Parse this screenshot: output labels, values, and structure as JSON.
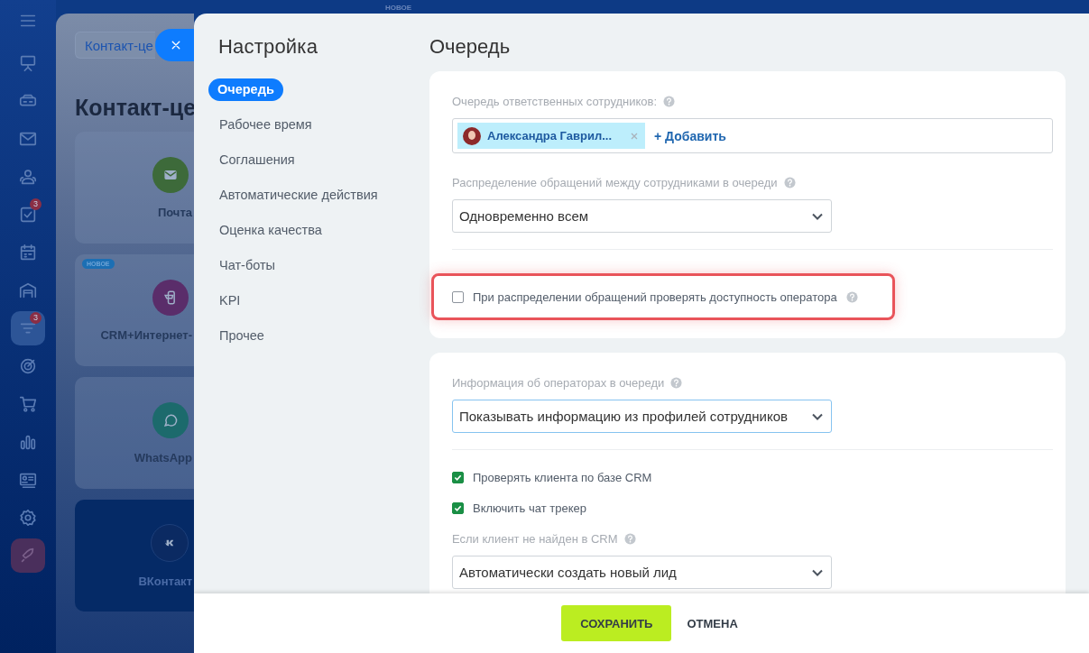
{
  "rail": {
    "items": [
      {
        "selected": false
      },
      {
        "selected": false
      },
      {
        "selected": false
      },
      {
        "selected": false
      },
      {
        "selected": false,
        "badge": "3"
      },
      {
        "selected": false
      },
      {
        "selected": false
      },
      {
        "selected": true,
        "badge": "3"
      },
      {
        "selected": false
      },
      {
        "selected": false
      },
      {
        "selected": false
      },
      {
        "selected": false
      },
      {
        "selected": false
      },
      {
        "selected": false
      }
    ]
  },
  "background_page": {
    "top_badge": "НОВОЕ",
    "breadcrumb": "Контакт-це",
    "title": "Контакт-це",
    "tiles": [
      {
        "label": "Почта",
        "color": "#3d6a3a",
        "selected": false
      },
      {
        "label": "CRM+Интернет-",
        "color": "#5a2d6a",
        "selected": false,
        "badge": "НОВОЕ"
      },
      {
        "label": "WhatsApp",
        "color": "#1c6a6c",
        "selected": false
      },
      {
        "label": "ВКонтакт",
        "color": "#0b2a62",
        "selected": true
      }
    ]
  },
  "settings": {
    "title": "Настройка",
    "nav": [
      {
        "label": "Очередь",
        "selected": true
      },
      {
        "label": "Рабочее время",
        "selected": false
      },
      {
        "label": "Соглашения",
        "selected": false
      },
      {
        "label": "Автоматические действия",
        "selected": false
      },
      {
        "label": "Оценка качества",
        "selected": false
      },
      {
        "label": "Чат-боты",
        "selected": false
      },
      {
        "label": "KPI",
        "selected": false
      },
      {
        "label": "Прочее",
        "selected": false
      }
    ],
    "heading": "Очередь",
    "cards": [
      {
        "fields": [
          {
            "kind": "people",
            "label": "Очередь ответственных сотрудников:",
            "help": true,
            "chips": [
              {
                "name": "Александра Гаврил..."
              }
            ],
            "add": "+ Добавить"
          },
          {
            "kind": "select",
            "label": "Распределение обращений между сотрудниками в очереди",
            "help": true,
            "value": "Одновременно всем",
            "focused": false
          },
          {
            "kind": "divider"
          },
          {
            "kind": "checkbox",
            "label": "При распределении обращений проверять доступность оператора",
            "help": true,
            "checked": false,
            "highlighted": true
          }
        ]
      },
      {
        "fields": [
          {
            "kind": "select",
            "label": "Информация об операторах в очереди",
            "help": true,
            "value": "Показывать информацию из профилей сотрудников",
            "focused": true
          },
          {
            "kind": "divider"
          },
          {
            "kind": "checkbox",
            "label": "Проверять клиента по базе CRM",
            "help": false,
            "checked": true,
            "highlighted": false
          },
          {
            "kind": "checkbox",
            "label": "Включить чат трекер",
            "help": false,
            "checked": true,
            "highlighted": false
          },
          {
            "kind": "select",
            "label": "Если клиент не найден в CRM",
            "help": true,
            "value": "Автоматически создать новый лид",
            "focused": false
          }
        ]
      }
    ],
    "footer": [
      {
        "label": "СОХРАНИТЬ",
        "kind": "primary"
      },
      {
        "label": "ОТМЕНА",
        "kind": "link"
      }
    ]
  }
}
